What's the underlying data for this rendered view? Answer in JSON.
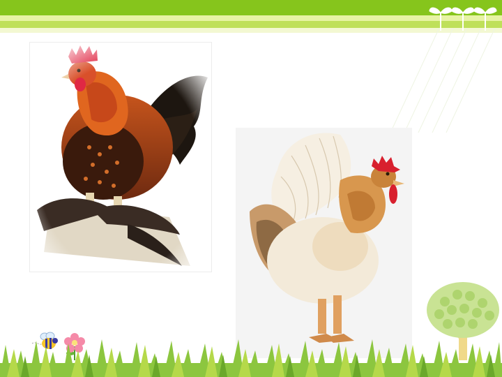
{
  "slide": {
    "background": "#ffffff",
    "header_colors": {
      "stripe_dark": "#86c51c",
      "stripe_light": "#e7f3a5",
      "stripe_mid": "#bfe05a",
      "stripe_pale": "#f3f8d2",
      "sprout": "#ffffff"
    },
    "decor_icons": [
      "sprout-icon",
      "sprout-icon",
      "sprout-icon",
      "bee-icon",
      "flower-icon",
      "tree-icon"
    ],
    "grass_colors": [
      "#8cc63f",
      "#b5d94a",
      "#6aa82a"
    ]
  },
  "images": [
    {
      "subject": "rooster-dark-orange",
      "accent": "#b8441a"
    },
    {
      "subject": "rooster-white-ruffled",
      "accent": "#d8a56a"
    }
  ]
}
